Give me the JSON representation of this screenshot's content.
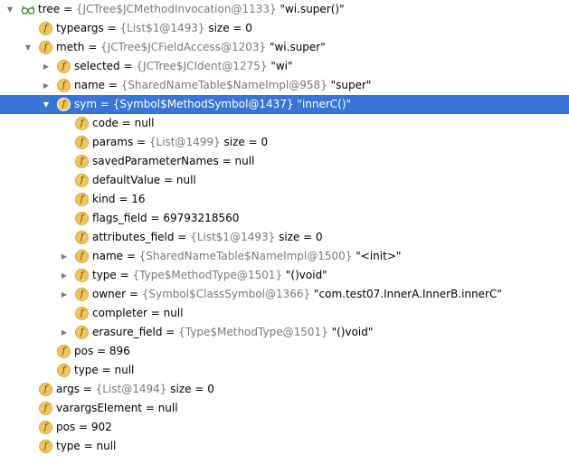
{
  "tree": {
    "rows": [
      {
        "indent": 0,
        "arrow": "expanded",
        "icon": "watch-icon",
        "name": "tree",
        "ref": "{JCTree$JCMethodInvocation@1133}",
        "value": "\"wi.super()\"",
        "selected": false
      },
      {
        "indent": 1,
        "arrow": "none",
        "icon": "field-icon",
        "name": "typeargs",
        "ref": "{List$1@1493}",
        "value": " size = 0",
        "selected": false
      },
      {
        "indent": 1,
        "arrow": "expanded",
        "icon": "field-icon",
        "name": "meth",
        "ref": "{JCTree$JCFieldAccess@1203}",
        "value": "\"wi.super\"",
        "selected": false
      },
      {
        "indent": 2,
        "arrow": "collapsed",
        "icon": "field-icon",
        "name": "selected",
        "ref": "{JCTree$JCIdent@1275}",
        "value": "\"wi\"",
        "selected": false
      },
      {
        "indent": 2,
        "arrow": "collapsed",
        "icon": "field-icon",
        "name": "name",
        "ref": "{SharedNameTable$NameImpl@958}",
        "value": "\"super\"",
        "selected": false
      },
      {
        "indent": 2,
        "arrow": "expanded",
        "icon": "field-icon",
        "name": "sym",
        "ref": "{Symbol$MethodSymbol@1437}",
        "value": "\"innerC()\"",
        "selected": true
      },
      {
        "indent": 3,
        "arrow": "none",
        "icon": "field-icon",
        "name": "code",
        "ref": "",
        "value": "null",
        "selected": false
      },
      {
        "indent": 3,
        "arrow": "none",
        "icon": "field-icon",
        "name": "params",
        "ref": "{List@1499}",
        "value": " size = 0",
        "selected": false
      },
      {
        "indent": 3,
        "arrow": "none",
        "icon": "field-icon",
        "name": "savedParameterNames",
        "ref": "",
        "value": "null",
        "selected": false
      },
      {
        "indent": 3,
        "arrow": "none",
        "icon": "field-icon",
        "name": "defaultValue",
        "ref": "",
        "value": "null",
        "selected": false
      },
      {
        "indent": 3,
        "arrow": "none",
        "icon": "field-icon",
        "name": "kind",
        "ref": "",
        "value": "16",
        "selected": false
      },
      {
        "indent": 3,
        "arrow": "none",
        "icon": "field-icon",
        "name": "flags_field",
        "ref": "",
        "value": "69793218560",
        "selected": false
      },
      {
        "indent": 3,
        "arrow": "none",
        "icon": "field-icon",
        "name": "attributes_field",
        "ref": "{List$1@1493}",
        "value": " size = 0",
        "selected": false
      },
      {
        "indent": 3,
        "arrow": "collapsed",
        "icon": "field-icon",
        "name": "name",
        "ref": "{SharedNameTable$NameImpl@1500}",
        "value": "\"<init>\"",
        "selected": false
      },
      {
        "indent": 3,
        "arrow": "collapsed",
        "icon": "field-icon",
        "name": "type",
        "ref": "{Type$MethodType@1501}",
        "value": "\"()void\"",
        "selected": false
      },
      {
        "indent": 3,
        "arrow": "collapsed",
        "icon": "field-icon",
        "name": "owner",
        "ref": "{Symbol$ClassSymbol@1366}",
        "value": "\"com.test07.InnerA.InnerB.innerC\"",
        "selected": false
      },
      {
        "indent": 3,
        "arrow": "none",
        "icon": "field-icon",
        "name": "completer",
        "ref": "",
        "value": "null",
        "selected": false
      },
      {
        "indent": 3,
        "arrow": "collapsed",
        "icon": "field-icon",
        "name": "erasure_field",
        "ref": "{Type$MethodType@1501}",
        "value": "\"()void\"",
        "selected": false
      },
      {
        "indent": 2,
        "arrow": "none",
        "icon": "field-icon",
        "name": "pos",
        "ref": "",
        "value": "896",
        "selected": false
      },
      {
        "indent": 2,
        "arrow": "none",
        "icon": "field-icon",
        "name": "type",
        "ref": "",
        "value": "null",
        "selected": false
      },
      {
        "indent": 1,
        "arrow": "none",
        "icon": "field-icon",
        "name": "args",
        "ref": "{List@1494}",
        "value": " size = 0",
        "selected": false
      },
      {
        "indent": 1,
        "arrow": "none",
        "icon": "field-icon",
        "name": "varargsElement",
        "ref": "",
        "value": "null",
        "selected": false
      },
      {
        "indent": 1,
        "arrow": "none",
        "icon": "field-icon",
        "name": "pos",
        "ref": "",
        "value": "902",
        "selected": false
      },
      {
        "indent": 1,
        "arrow": "none",
        "icon": "field-icon",
        "name": "type",
        "ref": "",
        "value": "null",
        "selected": false
      }
    ],
    "field_icon_letter": "f",
    "equals": " = ",
    "arrow_expanded_glyph": "▼",
    "arrow_collapsed_glyph": "▶",
    "colors": {
      "selection": "#3875d6",
      "field_icon": "#f2c55c",
      "ref_text": "#7a7a7a"
    }
  }
}
